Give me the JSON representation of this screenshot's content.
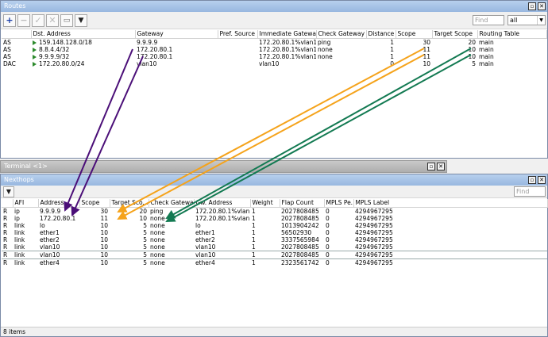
{
  "routes": {
    "title": "Routes",
    "find_placeholder": "Find",
    "filter_value": "all",
    "columns": [
      "",
      "Dst. Address",
      "Gateway",
      "Pref. Source",
      "Immediate Gateway",
      "Check Gateway",
      "Distance",
      "Scope",
      "Target Scope",
      "Routing Table"
    ],
    "rows": [
      {
        "flag": "AS",
        "dst": "159.148.128.0/18",
        "gateway": "9.9.9.9",
        "pref": "",
        "imm": "172.20.80.1%vlan10",
        "check": "ping",
        "distance": "1",
        "scope": "30",
        "target": "20",
        "table": "main"
      },
      {
        "flag": "AS",
        "dst": "8.8.4.4/32",
        "gateway": "172.20.80.1",
        "pref": "",
        "imm": "172.20.80.1%vlan10",
        "check": "none",
        "distance": "1",
        "scope": "11",
        "target": "10",
        "table": "main"
      },
      {
        "flag": "AS",
        "dst": "9.9.9.9/32",
        "gateway": "172.20.80.1",
        "pref": "",
        "imm": "172.20.80.1%vlan10",
        "check": "none",
        "distance": "1",
        "scope": "11",
        "target": "10",
        "table": "main"
      },
      {
        "flag": "DAC",
        "dst": "172.20.80.0/24",
        "gateway": "vlan10",
        "pref": "",
        "imm": "vlan10",
        "check": "",
        "distance": "0",
        "scope": "10",
        "target": "5",
        "table": "main"
      }
    ]
  },
  "terminal": {
    "title": "Terminal <1>"
  },
  "nexthops": {
    "title": "Nexthops",
    "find_placeholder": "Find",
    "columns": [
      "",
      "AFI",
      "Address",
      "Scope",
      "Target Sco...",
      "Check Gateway",
      "Gw. Address",
      "Weight",
      "Flap Count",
      "MPLS Pe...",
      "MPLS Label"
    ],
    "rows": [
      {
        "flag": "R",
        "afi": "ip",
        "address": "9.9.9.9",
        "scope": "30",
        "target": "20",
        "check": "ping",
        "gw": "172.20.80.1%vlan10",
        "weight": "1",
        "flap": "2027808485",
        "mpls": "0",
        "label": "4294967295"
      },
      {
        "flag": "R",
        "afi": "ip",
        "address": "172.20.80.1",
        "scope": "11",
        "target": "10",
        "check": "none",
        "gw": "172.20.80.1%vlan10",
        "weight": "1",
        "flap": "2027808485",
        "mpls": "0",
        "label": "4294967295"
      },
      {
        "flag": "R",
        "afi": "link",
        "address": "lo",
        "scope": "10",
        "target": "5",
        "check": "none",
        "gw": "lo",
        "weight": "1",
        "flap": "1013904242",
        "mpls": "0",
        "label": "4294967295"
      },
      {
        "flag": "R",
        "afi": "link",
        "address": "ether1",
        "scope": "10",
        "target": "5",
        "check": "none",
        "gw": "ether1",
        "weight": "1",
        "flap": "56502930",
        "mpls": "0",
        "label": "4294967295"
      },
      {
        "flag": "R",
        "afi": "link",
        "address": "ether2",
        "scope": "10",
        "target": "5",
        "check": "none",
        "gw": "ether2",
        "weight": "1",
        "flap": "3337565984",
        "mpls": "0",
        "label": "4294967295"
      },
      {
        "flag": "R",
        "afi": "link",
        "address": "vlan10",
        "scope": "10",
        "target": "5",
        "check": "none",
        "gw": "vlan10",
        "weight": "1",
        "flap": "2027808485",
        "mpls": "0",
        "label": "4294967295"
      },
      {
        "flag": "R",
        "afi": "link",
        "address": "vlan10",
        "scope": "10",
        "target": "5",
        "check": "none",
        "gw": "vlan10",
        "weight": "1",
        "flap": "2027808485",
        "mpls": "0",
        "label": "4294967295"
      },
      {
        "flag": "R",
        "afi": "link",
        "address": "ether4",
        "scope": "10",
        "target": "5",
        "check": "none",
        "gw": "ether4",
        "weight": "1",
        "flap": "2323561742",
        "mpls": "0",
        "label": "4294967295"
      }
    ],
    "status": "8 items"
  },
  "colors": {
    "purple": "#4b0f78",
    "orange": "#f5a31b",
    "green": "#137a52",
    "title_blue": "#9fbce2"
  }
}
